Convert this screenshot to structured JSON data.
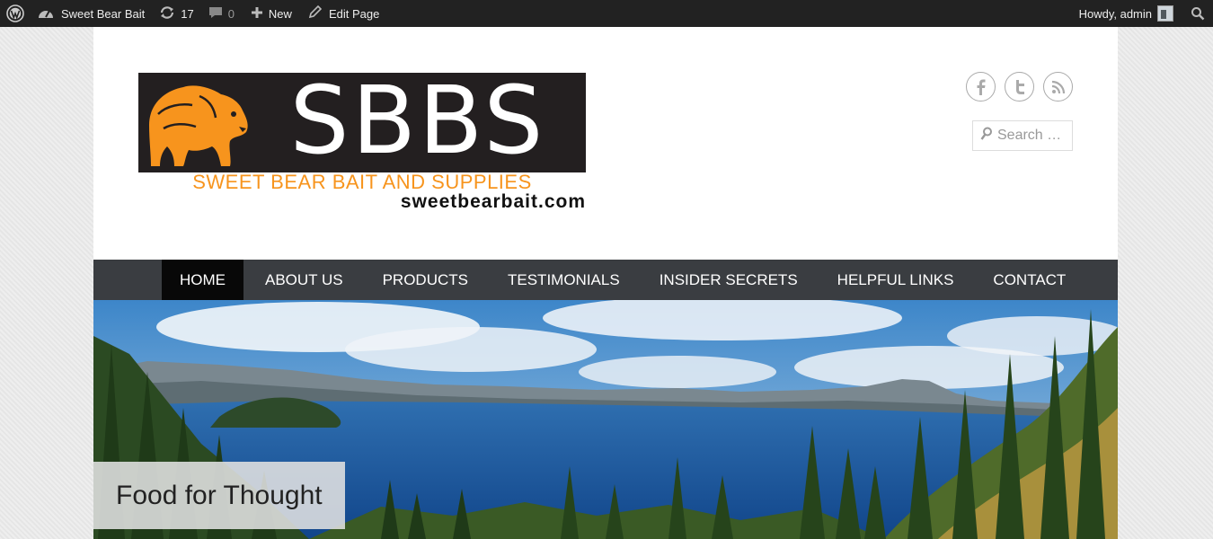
{
  "admin_bar": {
    "site_name": "Sweet Bear Bait",
    "updates_count": "17",
    "comments_count": "0",
    "new_label": "New",
    "edit_label": "Edit Page",
    "howdy": "Howdy, admin"
  },
  "header": {
    "logo": {
      "letters": "SBBS",
      "tagline": "SWEET BEAR BAIT AND SUPPLIES",
      "url": "sweetbearbait.com"
    },
    "social_icons": [
      "facebook-icon",
      "twitter-icon",
      "rss-icon"
    ],
    "search_placeholder": "Search …"
  },
  "nav": {
    "items": [
      "HOME",
      "ABOUT US",
      "PRODUCTS",
      "TESTIMONIALS",
      "INSIDER SECRETS",
      "HELPFUL LINKS",
      "CONTACT"
    ],
    "active": "HOME"
  },
  "banner": {
    "caption": "Food for Thought"
  },
  "colors": {
    "admin_bar_bg": "#222222",
    "nav_bg": "#3a3d41",
    "nav_active_bg": "#080808",
    "logo_orange": "#f7941d"
  }
}
